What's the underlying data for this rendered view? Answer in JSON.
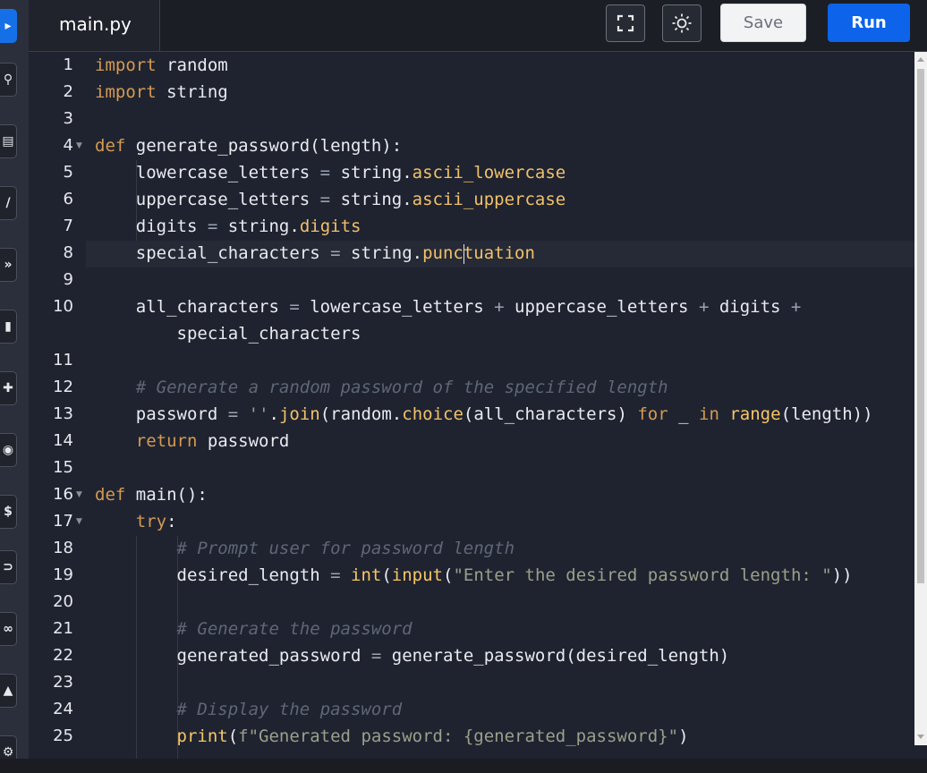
{
  "tab": {
    "file_name": "main.py"
  },
  "toolbar": {
    "fullscreen_icon": "fullscreen-icon",
    "theme_icon": "sun-icon",
    "save_label": "Save",
    "run_label": "Run"
  },
  "sidebar": {
    "icons": [
      "active-icon",
      "search-icon",
      "notebook-icon",
      "edit-icon",
      "arrow-icon",
      "bookmark-icon",
      "puzzle-icon",
      "code-icon",
      "dollar-icon",
      "link-icon",
      "snippet-icon",
      "user-icon",
      "settings-icon"
    ]
  },
  "editor": {
    "line_numbers": [
      "1",
      "2",
      "3",
      "4",
      "5",
      "6",
      "7",
      "8",
      "9",
      "10",
      "11",
      "12",
      "13",
      "14",
      "15",
      "16",
      "17",
      "18",
      "19",
      "20",
      "21",
      "22",
      "23",
      "24",
      "25"
    ],
    "lines": [
      "import random",
      "import string",
      "",
      "def generate_password(length):",
      "    lowercase_letters = string.ascii_lowercase",
      "    uppercase_letters = string.ascii_uppercase",
      "    digits = string.digits",
      "    special_characters = string.punctuation",
      "",
      "    all_characters = lowercase_letters + uppercase_letters + digits +",
      "        special_characters",
      "",
      "    # Generate a random password of the specified length",
      "    password = ''.join(random.choice(all_characters) for _ in range(length))",
      "    return password",
      "",
      "def main():",
      "    try:",
      "        # Prompt user for password length",
      "        desired_length = int(input(\"Enter the desired password length: \"))",
      "",
      "        # Generate the password",
      "        generated_password = generate_password(desired_length)",
      "",
      "        # Display the password",
      "        print(f\"Generated password: {generated_password}\")"
    ]
  }
}
